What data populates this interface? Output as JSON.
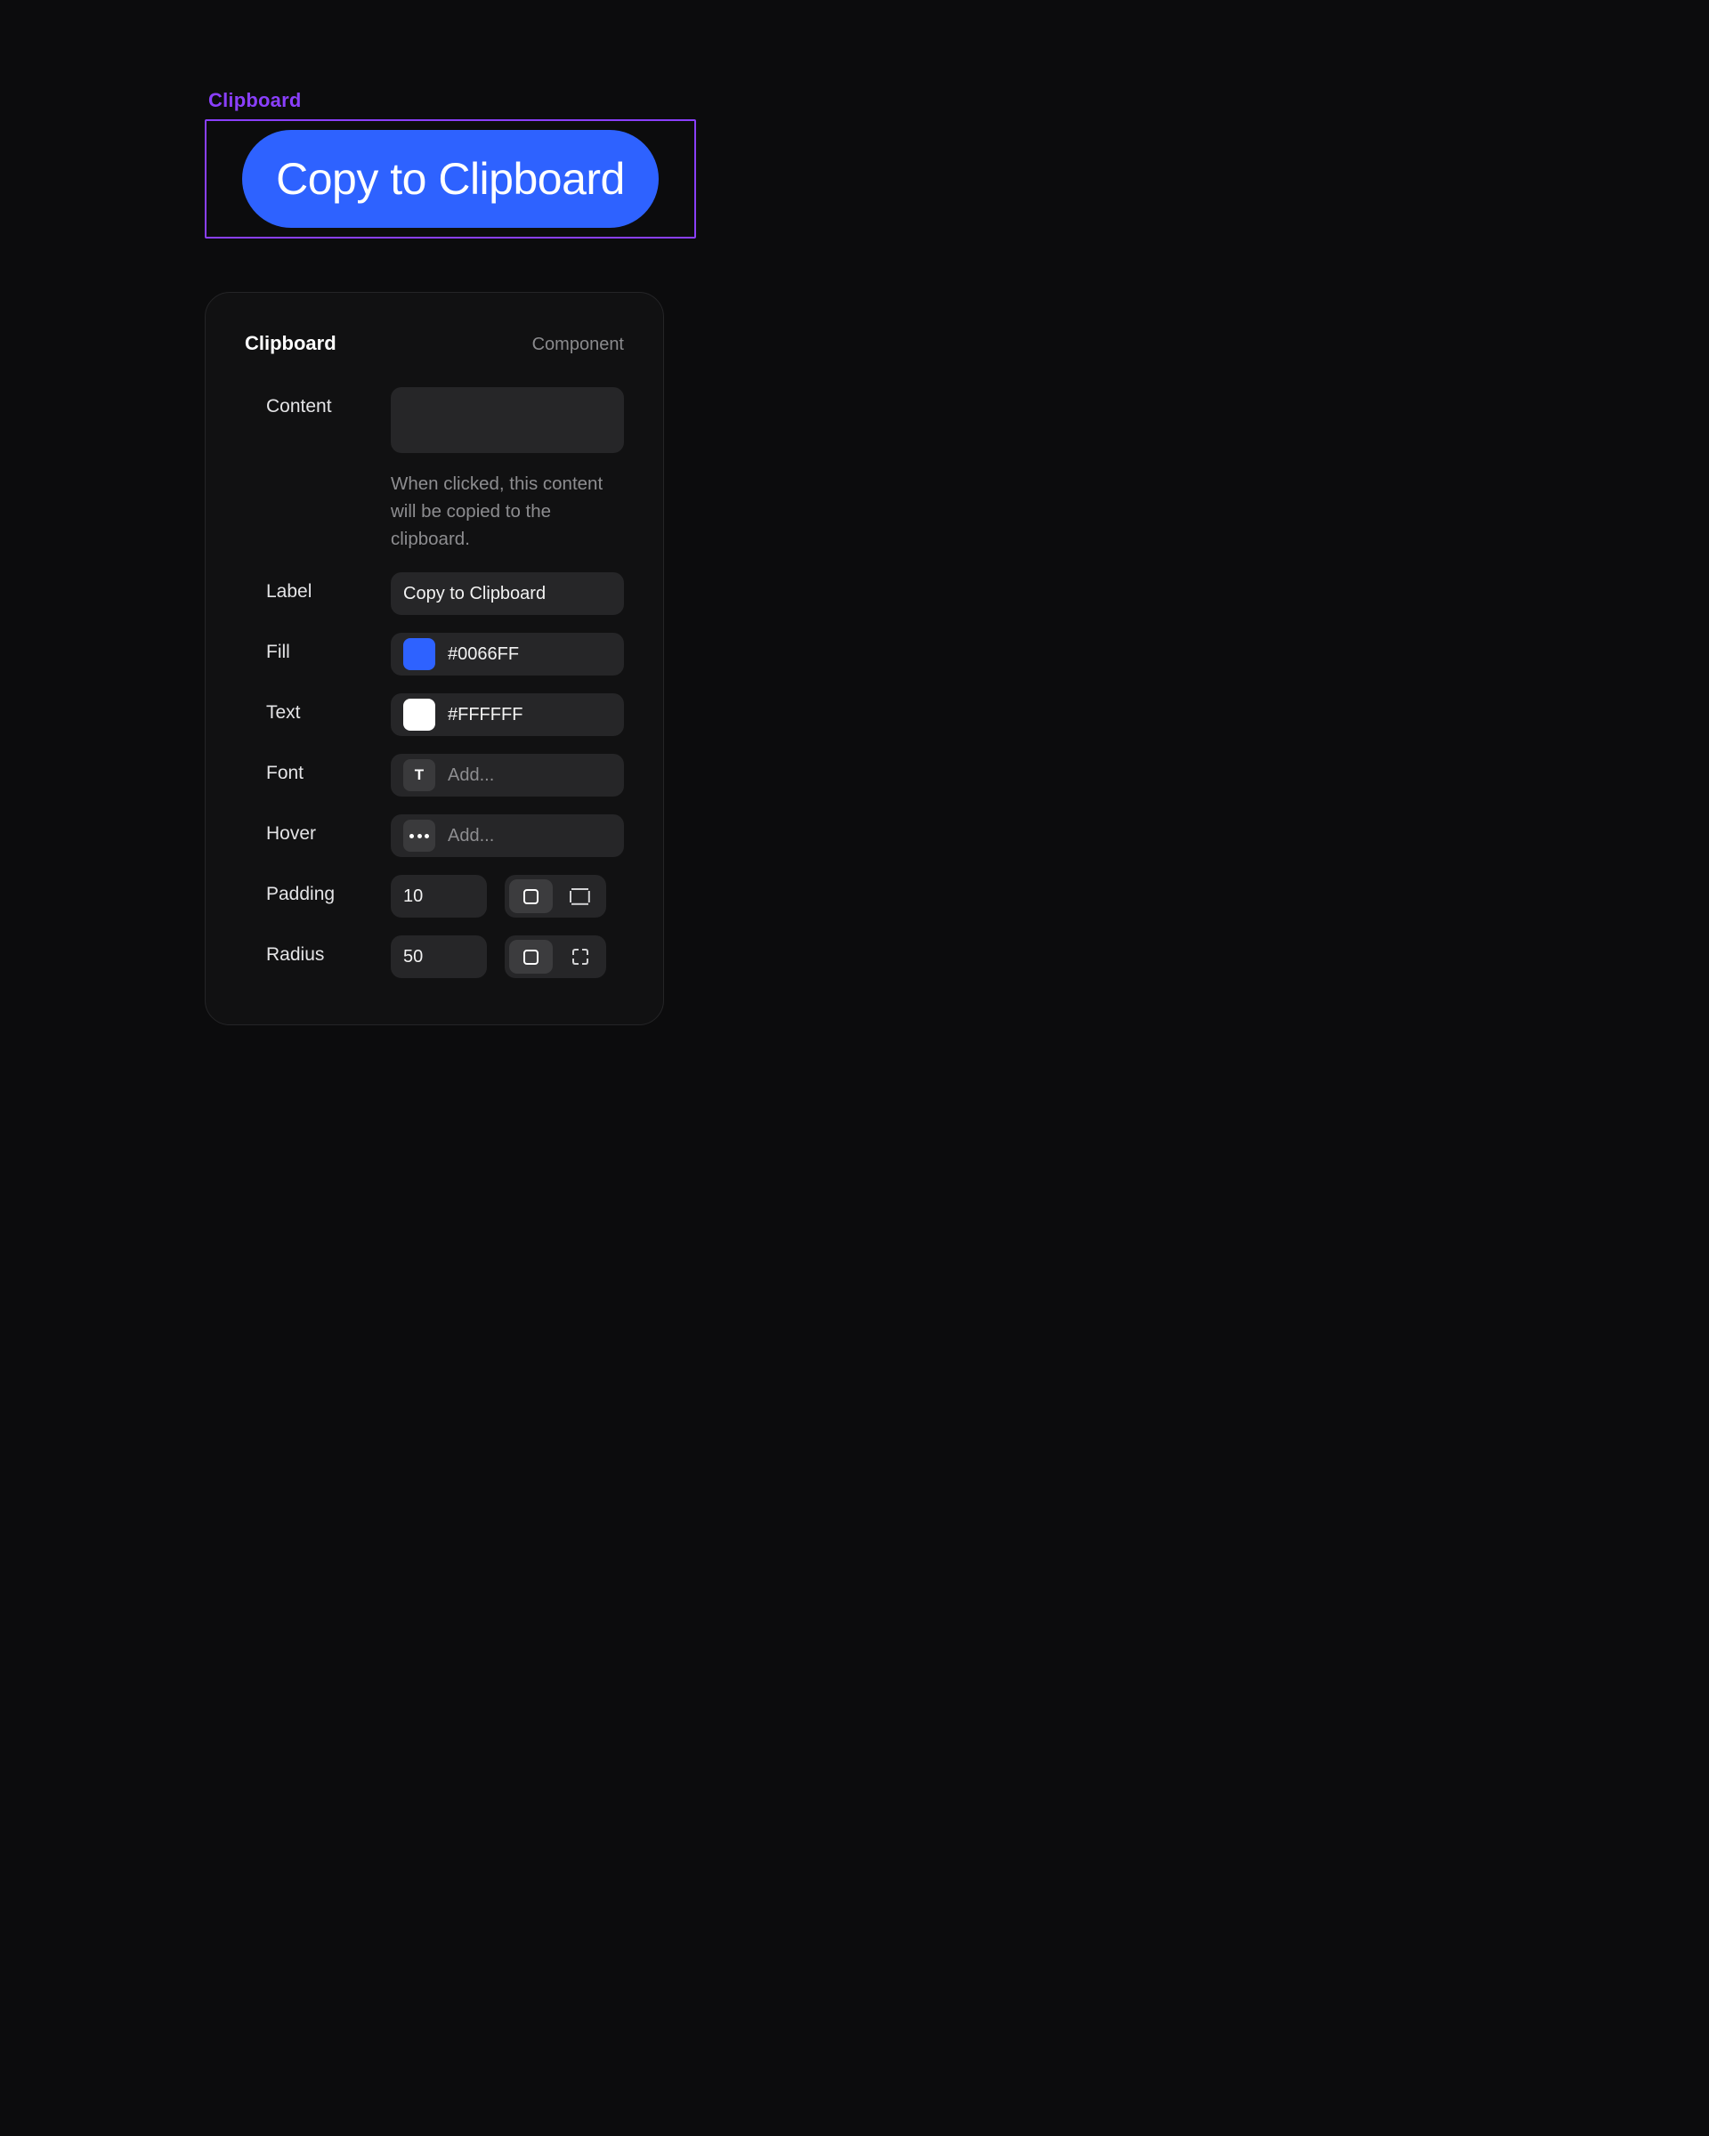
{
  "selection": {
    "name_label": "Clipboard",
    "button_text": "Copy to Clipboard"
  },
  "panel": {
    "title": "Clipboard",
    "type": "Component",
    "content": {
      "label": "Content",
      "value": "",
      "help": "When clicked, this content will be copied to the clipboard."
    },
    "label_row": {
      "label": "Label",
      "value": "Copy to Clipboard"
    },
    "fill": {
      "label": "Fill",
      "value": "#0066FF",
      "swatch": "#2e62ff"
    },
    "text": {
      "label": "Text",
      "value": "#FFFFFF",
      "swatch": "#ffffff"
    },
    "font": {
      "label": "Font",
      "placeholder": "Add..."
    },
    "hover": {
      "label": "Hover",
      "placeholder": "Add..."
    },
    "padding": {
      "label": "Padding",
      "value": "10",
      "mode": "single"
    },
    "radius": {
      "label": "Radius",
      "value": "50",
      "mode": "single"
    }
  }
}
